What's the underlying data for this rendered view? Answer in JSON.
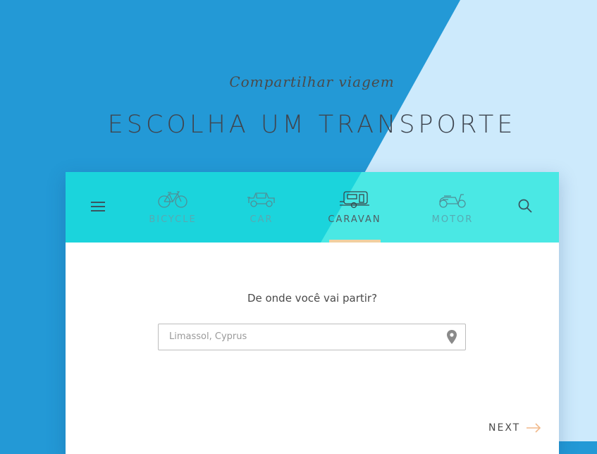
{
  "header": {
    "subtitle": "Compartilhar viagem",
    "title": "ESCOLHA UM TRANSPORTE"
  },
  "nav": {
    "menu_icon": "hamburger-menu-icon",
    "search_icon": "search-icon",
    "active_tab": "CARAVAN",
    "tabs": [
      {
        "label": "BICYCLE",
        "icon": "bicycle-icon"
      },
      {
        "label": "CAR",
        "icon": "car-icon"
      },
      {
        "label": "CARAVAN",
        "icon": "caravan-icon"
      },
      {
        "label": "MOTOR",
        "icon": "scooter-icon"
      }
    ]
  },
  "form": {
    "question": "De onde você vai partir?",
    "location_placeholder": "Limassol, Cyprus",
    "location_value": "",
    "location_icon": "map-pin-icon"
  },
  "footer": {
    "next_label": "NEXT",
    "next_icon": "arrow-right-icon"
  },
  "colors": {
    "background_dark": "#2399d6",
    "background_light": "#cdeafc",
    "nav_primary": "#1bd4dc",
    "nav_secondary": "#4ae8e4",
    "accent_underline": "#f1cfa0",
    "arrow_accent": "#f1b98a"
  }
}
